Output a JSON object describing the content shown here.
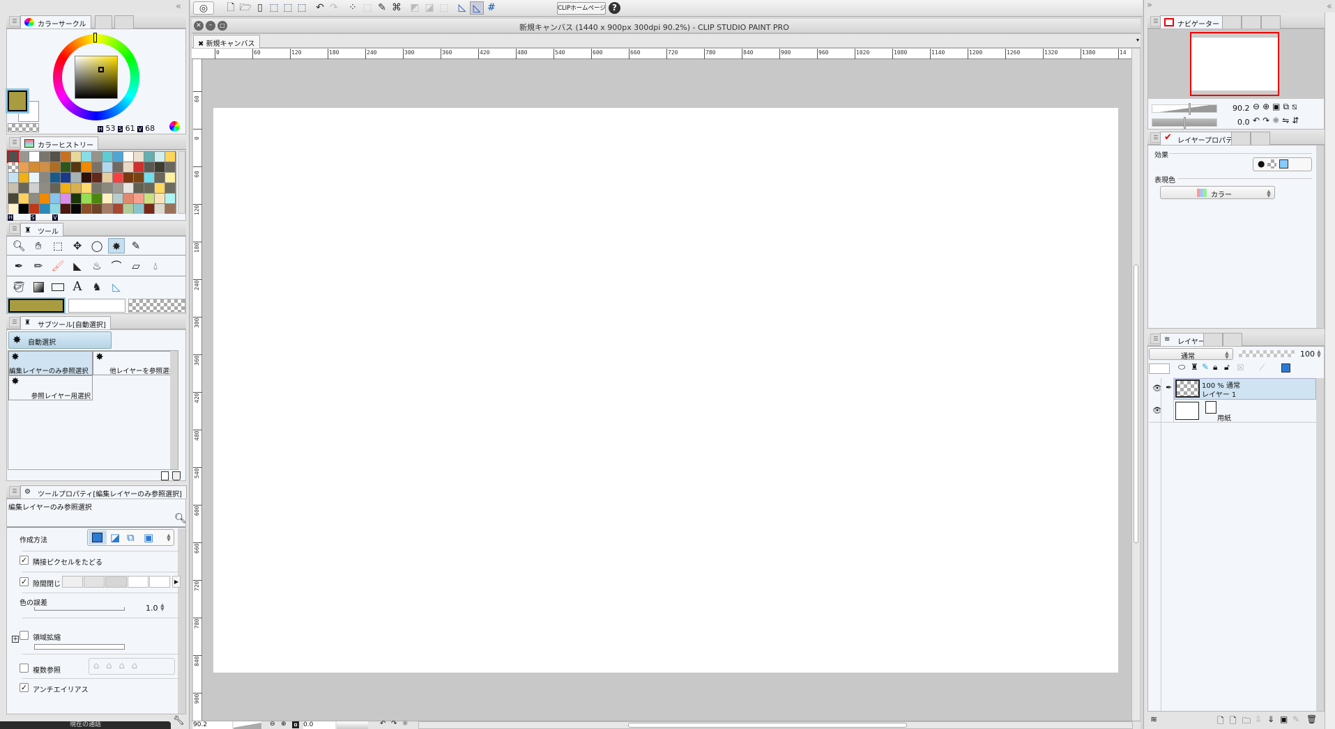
{
  "toolbar": {
    "home_button": "CLIPホームページ",
    "help": "?"
  },
  "window": {
    "title": "新規キャンバス (1440 x 900px 300dpi 90.2%)  - CLIP STUDIO PAINT PRO",
    "doc_tab": "新規キャンバス"
  },
  "ruler": {
    "h_labels": [
      "0",
      "60",
      "120",
      "180",
      "240",
      "300",
      "360",
      "420",
      "480",
      "540",
      "600",
      "660",
      "720",
      "780",
      "840",
      "900",
      "960",
      "1020",
      "1080",
      "1140",
      "1200",
      "1260",
      "1320",
      "1380",
      "14"
    ],
    "v_labels": [
      "60",
      "0",
      "60",
      "120",
      "180",
      "240",
      "300",
      "360",
      "420",
      "480",
      "540",
      "600",
      "660",
      "720",
      "780",
      "840",
      "900"
    ]
  },
  "color_circle": {
    "tab": "カラーサークル",
    "h_label": "H",
    "h": "53",
    "s_label": "S",
    "s": "61",
    "v_label": "V",
    "v": "68",
    "main_color": "#a99c40",
    "sub_color": "#ffffff"
  },
  "color_history": {
    "tab": "カラーヒストリー",
    "hsv_labels": [
      "H",
      "S",
      "V"
    ],
    "colors": [
      [
        "#505050",
        "#9a9792",
        "#ffffff",
        "#7a766e",
        "#55514b",
        "#c87020",
        "#e6d89a",
        "#88dde8",
        "#97948c",
        "#5fcbd3",
        "#4fa5d5",
        "#fffaf4",
        "#ede0d0",
        "#64b0b0",
        "#d0eeee",
        "#ffd45a"
      ],
      [
        "checker",
        "#e8a050",
        "#d48c34",
        "#d09048",
        "#b06c20",
        "#30561a",
        "#583810",
        "#f08a00",
        "#7a7264",
        "#b0d8ee",
        "#706a60",
        "#ead8c4",
        "#d03030",
        "#5a5850",
        "#403c30",
        "#6a685e"
      ],
      [
        "#c4e2f4",
        "#f0b010",
        "#e8f4fa",
        "#8a887e",
        "#1a5a8a",
        "#183a8a",
        "#a8b4b4",
        "#301008",
        "#64281a",
        "#e4cca0",
        "#f84040",
        "#7a3810",
        "#7a4412",
        "#70e0ec",
        "#6a6858",
        "#fff0a0"
      ],
      [
        "#c8c0ac",
        "#6a665a",
        "#d0d0d0",
        "#8e8c84",
        "#666256",
        "#f0b010",
        "#d8b050",
        "#ffd870",
        "#767468",
        "#8a887c",
        "#a09c94",
        "#e8e4e0",
        "#626050",
        "#6a6858",
        "#ffd860",
        "#6e6c60"
      ],
      [
        "#4a4638",
        "#ffd060",
        "#8e8c84",
        "#f08a00",
        "#88c4ec",
        "#d890ec",
        "#1a3808",
        "#98dc58",
        "#4c8810",
        "#fff0c0",
        "#b8cccc",
        "#e08870",
        "#f8a090",
        "#cce080",
        "#f8e4b8",
        "#b0f4f4"
      ],
      [
        "#fff0d0",
        "#000000",
        "#c03818",
        "#2c88b8",
        "#8cd8e4",
        "#4a1810",
        "#080808",
        "#8c5028",
        "#704428",
        "#a87c64",
        "#a84830",
        "#b0cc98",
        "#8cc4cc",
        "#782818",
        "#dcd8cc",
        "#9c7058"
      ]
    ]
  },
  "tools": {
    "tab": "ツール",
    "text_tool_glyph": "A"
  },
  "subtool": {
    "tab": "サブツール[自動選択]",
    "group": "自動選択",
    "items": [
      "編集レイヤーのみ参照選択",
      "他レイヤーを参照選択",
      "参照レイヤー用選択"
    ]
  },
  "tool_property": {
    "tab": "ツールプロパティ[編集レイヤーのみ参照選択]",
    "title": "編集レイヤーのみ参照選択",
    "creation_method": "作成方法",
    "follow_adjacent": "隣接ピクセルをたどる",
    "close_gap": "隙間閉じ",
    "color_tolerance": "色の誤差",
    "color_tolerance_value": "1.0",
    "area_scaling": "領域拡縮",
    "multiple_ref": "複数参照",
    "antialias": "アンチエイリアス",
    "follow_adjacent_checked": true,
    "close_gap_checked": true,
    "area_scaling_checked": false,
    "multiple_ref_checked": false,
    "antialias_checked": true
  },
  "call_bar": "現在の通話",
  "navigator": {
    "tab": "ナビゲーター",
    "zoom": "90.2",
    "rotation": "0.0"
  },
  "layer_property": {
    "tab": "レイヤープロパティ",
    "effect": "効果",
    "expression_color": "表現色",
    "expression_value": "カラー"
  },
  "layers": {
    "tab": "レイヤー",
    "blend_mode": "通常",
    "opacity": "100",
    "items": [
      {
        "info": "100 % 通常",
        "name": "レイヤー 1"
      },
      {
        "name": "用紙"
      }
    ]
  },
  "status": {
    "zoom": "90.2",
    "rotation": "0.0"
  },
  "accent": "#3c8fe0"
}
